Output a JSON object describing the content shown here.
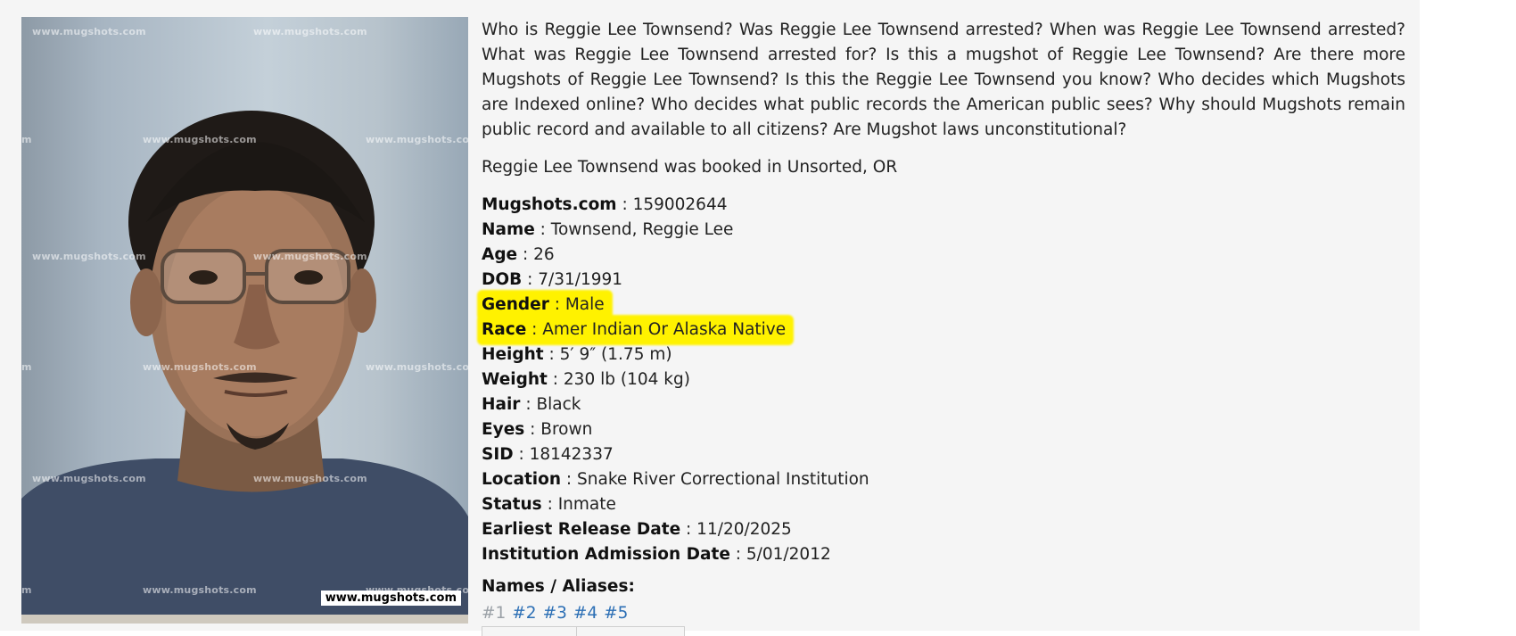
{
  "photo": {
    "watermark_text": "www.mugshots.com",
    "watermark_partial": "m",
    "corner_badge": "www.mugshots.com"
  },
  "intro_text": "Who is Reggie Lee Townsend? Was Reggie Lee Townsend arrested? When was Reggie Lee Townsend arrested? What was Reggie Lee Townsend arrested for? Is this a mugshot of Reggie Lee Townsend? Are there more Mugshots of Reggie Lee Townsend? Is this the Reggie Lee Townsend you know? Who decides which Mugshots are Indexed online? Who decides what public records the American public sees? Why should Mugshots remain public record and available to all citizens? Are Mugshot laws unconstitutional?",
  "booked_text": "Reggie Lee Townsend was booked in Unsorted, OR",
  "details": [
    {
      "label": "Mugshots.com",
      "value": "159002644"
    },
    {
      "label": "Name",
      "value": "Townsend, Reggie Lee"
    },
    {
      "label": "Age",
      "value": "26"
    },
    {
      "label": "DOB",
      "value": "7/31/1991"
    },
    {
      "label": "Gender",
      "value": "Male"
    },
    {
      "label": "Race",
      "value": "Amer Indian Or Alaska Native"
    },
    {
      "label": "Height",
      "value": "5′ 9″ (1.75 m)"
    },
    {
      "label": "Weight",
      "value": "230 lb (104 kg)"
    },
    {
      "label": "Hair",
      "value": "Black"
    },
    {
      "label": "Eyes",
      "value": "Brown"
    },
    {
      "label": "SID",
      "value": "18142337"
    },
    {
      "label": "Location",
      "value": "Snake River Correctional Institution"
    },
    {
      "label": "Status",
      "value": "Inmate"
    },
    {
      "label": "Earliest Release Date",
      "value": "11/20/2025"
    },
    {
      "label": "Institution Admission Date",
      "value": "5/01/2012"
    }
  ],
  "separator": " : ",
  "aliases": {
    "title": "Names / Aliases:",
    "links": [
      "#1",
      "#2",
      "#3",
      "#4",
      "#5"
    ]
  },
  "colors": {
    "highlight": "#fff200",
    "link": "#2c6fb5",
    "link_current": "#9aa0a6",
    "panel_bg": "#f5f5f5"
  }
}
